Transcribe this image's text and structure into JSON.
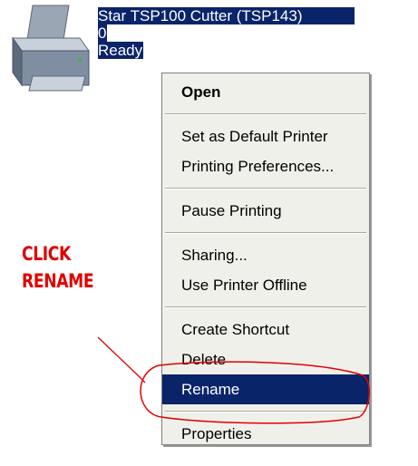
{
  "printer": {
    "name": "Star TSP100 Cutter (TSP143)",
    "documents": "0",
    "status": "Ready",
    "icon": "printer-icon"
  },
  "annotation": {
    "line1": "CLICK",
    "line2": "RENAME",
    "color": "#e00000"
  },
  "context_menu": {
    "open": "Open",
    "set_default": "Set as Default Printer",
    "preferences": "Printing Preferences...",
    "pause": "Pause Printing",
    "sharing": "Sharing...",
    "offline": "Use Printer Offline",
    "shortcut": "Create Shortcut",
    "delete": "Delete",
    "rename": "Rename",
    "properties": "Properties"
  },
  "colors": {
    "selection": "#0a246a",
    "menu_background": "#f0f0ea"
  }
}
